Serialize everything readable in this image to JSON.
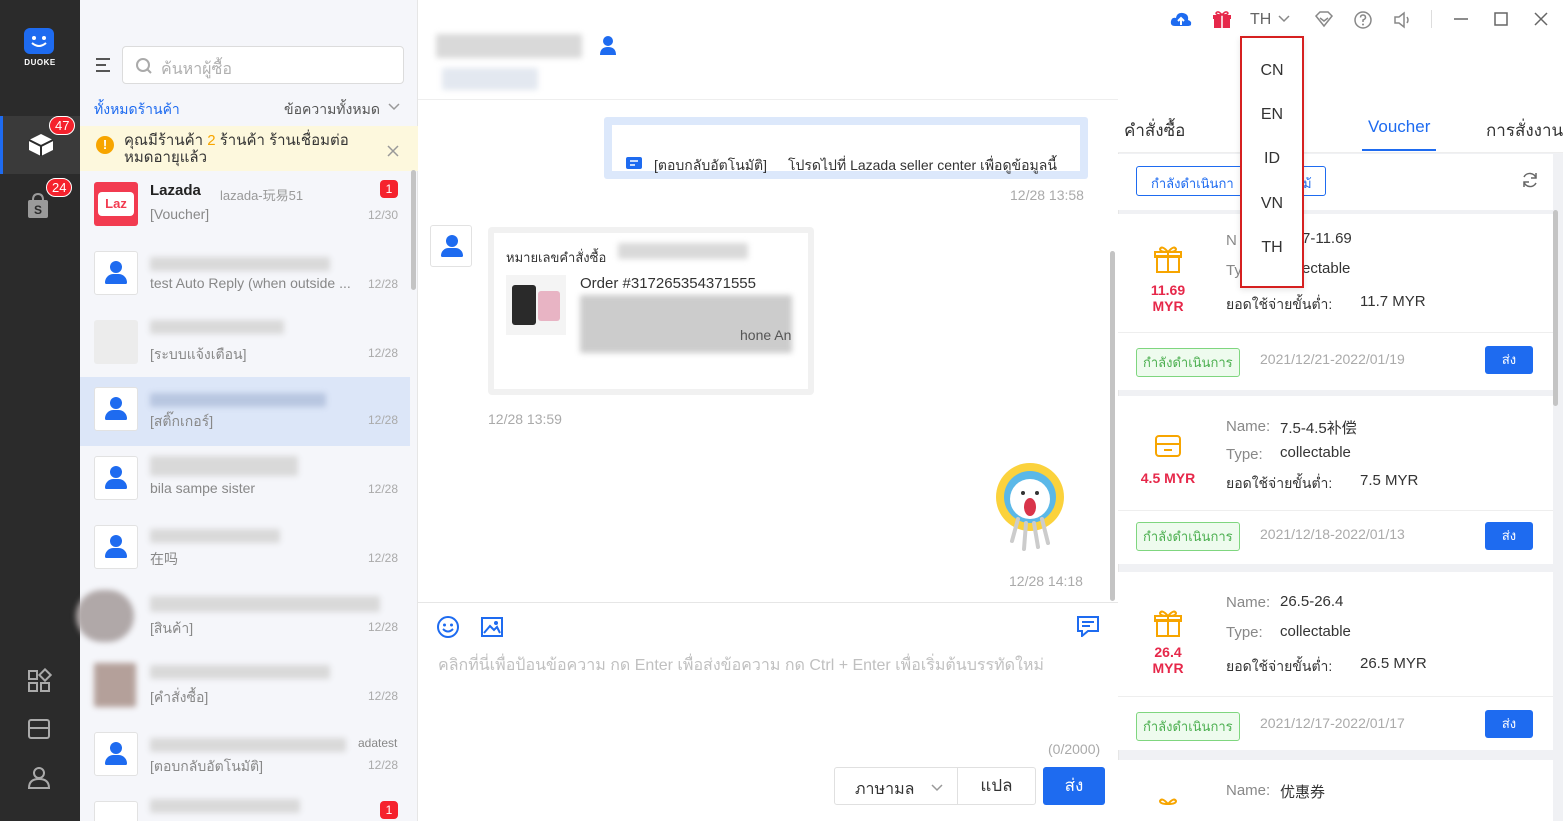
{
  "app": {
    "logo_text": "DUOKE",
    "nav_badges": [
      "47",
      "24"
    ]
  },
  "titlebar": {
    "lang": "TH"
  },
  "language_dropdown": {
    "options": [
      "CN",
      "EN",
      "ID",
      "VN",
      "TH"
    ]
  },
  "sidebar": {
    "search_placeholder": "ค้นหาผู้ซื้อ",
    "filter_shop": "ทั้งหมดร้านค้า",
    "filter_messages": "ข้อความทั้งหมด",
    "notice": {
      "prefix": "คุณมีร้านค้า",
      "count": "2",
      "suffix": "ร้านค้า ร้านเชื่อมต่อ",
      "line2": "หมดอายุแล้ว"
    },
    "conversations": [
      {
        "name": "Lazada",
        "sub": "lazada-玩易51",
        "msg": "[Voucher]",
        "time": "12/30",
        "unread": "1"
      },
      {
        "msg": "test Auto Reply (when outside ...",
        "time": "12/28"
      },
      {
        "msg": "[ระบบแจ้งเตือน]",
        "time": "12/28"
      },
      {
        "msg": "[สติ๊กเกอร์]",
        "time": "12/28"
      },
      {
        "msg": "bila sampe sister",
        "time": "12/28"
      },
      {
        "msg": "在吗",
        "time": "12/28"
      },
      {
        "msg": "[สินค้า]",
        "time": "12/28"
      },
      {
        "msg": "[คำสั่งซื้อ]",
        "time": "12/28"
      },
      {
        "sub": "adatest",
        "msg": "[ตอบกลับอัตโนมัติ]",
        "time": "12/28"
      },
      {
        "unread": "1"
      }
    ]
  },
  "chat": {
    "auto_reply_tag": "[ตอบกลับอัตโนมัติ]",
    "auto_reply_text": "โปรดไปที่ Lazada seller center เพื่อดูข้อมูลนี้",
    "time1": "12/28 13:58",
    "order_label": "หมายเลขคำสั่งซื้อ",
    "order_number": "Order #317265354371555",
    "order_product_fragment": "hone An",
    "time2": "12/28 13:59",
    "time3": "12/28 14:18",
    "input_placeholder": "คลิกที่นี่เพื่อป้อนข้อความ กด Enter เพื่อส่งข้อความ กด Ctrl + Enter เพื่อเริ่มต้นบรรทัดใหม่",
    "counter": "(0/2000)",
    "lang_select": "ภาษามล",
    "translate_btn": "แปล",
    "send_btn": "ส่ง"
  },
  "right_panel": {
    "tabs": [
      "คำสั่งซื้อ",
      "Voucher",
      "การสั่งงาน"
    ],
    "filter_chip": "กำลังดำเนินกา",
    "filter_chip_tail": "ม้",
    "vouchers": [
      {
        "amount": "11.69",
        "currency": "MYR",
        "name": "7-11.69",
        "type": "ectable",
        "min_label": "ยอดใช้จ่ายขั้นต่ำ:",
        "min": "11.7 MYR",
        "status": "กำลังดำเนินการ",
        "period": "2021/12/21-2022/01/19",
        "send": "ส่ง"
      },
      {
        "amount": "4.5 MYR",
        "name_label": "Name:",
        "name": "7.5-4.5补偿",
        "type_label": "Type:",
        "type": "collectable",
        "min_label": "ยอดใช้จ่ายขั้นต่ำ:",
        "min": "7.5 MYR",
        "status": "กำลังดำเนินการ",
        "period": "2021/12/18-2022/01/13",
        "send": "ส่ง"
      },
      {
        "amount": "26.4",
        "currency": "MYR",
        "name_label": "Name:",
        "name": "26.5-26.4",
        "type_label": "Type:",
        "type": "collectable",
        "min_label": "ยอดใช้จ่ายขั้นต่ำ:",
        "min": "26.5 MYR",
        "status": "กำลังดำเนินการ",
        "period": "2021/12/17-2022/01/17",
        "send": "ส่ง"
      },
      {
        "name_label": "Name:",
        "name": "优惠券"
      }
    ],
    "partial_labels": {
      "name": "N",
      "type": "Ty"
    }
  },
  "colors": {
    "accent": "#1e6bf0",
    "badge": "#f5222d",
    "voucher_amount": "#e6284a",
    "status_green": "#4caf50",
    "dropdown_border": "#d62020"
  }
}
